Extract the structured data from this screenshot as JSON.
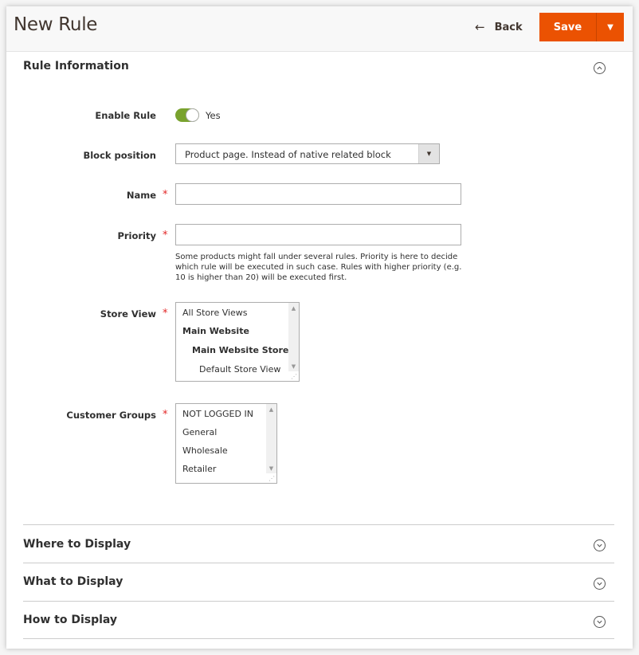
{
  "header": {
    "title": "New Rule",
    "back_label": "Back",
    "back_icon": "arrow-left-icon",
    "save_label": "Save",
    "save_menu_icon": "caret-down-icon"
  },
  "colors": {
    "primary_action": "#eb5202",
    "toggle_on": "#79a22e",
    "required": "#e22626"
  },
  "sections": [
    {
      "title": "Rule Information",
      "expanded": true,
      "icon": "chevron-up-circle-icon"
    },
    {
      "title": "Where to Display",
      "expanded": false,
      "icon": "chevron-down-circle-icon"
    },
    {
      "title": "What to Display",
      "expanded": false,
      "icon": "chevron-down-circle-icon"
    },
    {
      "title": "How to Display",
      "expanded": false,
      "icon": "chevron-down-circle-icon"
    }
  ],
  "form": {
    "enable_rule": {
      "label": "Enable Rule",
      "value": true,
      "value_label": "Yes"
    },
    "block_position": {
      "label": "Block position",
      "value": "Product page. Instead of native related block"
    },
    "name": {
      "label": "Name",
      "required": true,
      "value": ""
    },
    "priority": {
      "label": "Priority",
      "required": true,
      "value": "",
      "note": "Some products might fall under several rules. Priority is here to decide which rule will be executed in such case. Rules with higher priority (e.g. 10 is higher than 20) will be executed first."
    },
    "store_view": {
      "label": "Store View",
      "required": true,
      "options": [
        "All Store Views",
        "Main Website",
        "Main Website Store",
        "Default Store View"
      ]
    },
    "customer_groups": {
      "label": "Customer Groups",
      "required": true,
      "options": [
        "NOT LOGGED IN",
        "General",
        "Wholesale",
        "Retailer"
      ]
    },
    "required_mark": "*"
  }
}
